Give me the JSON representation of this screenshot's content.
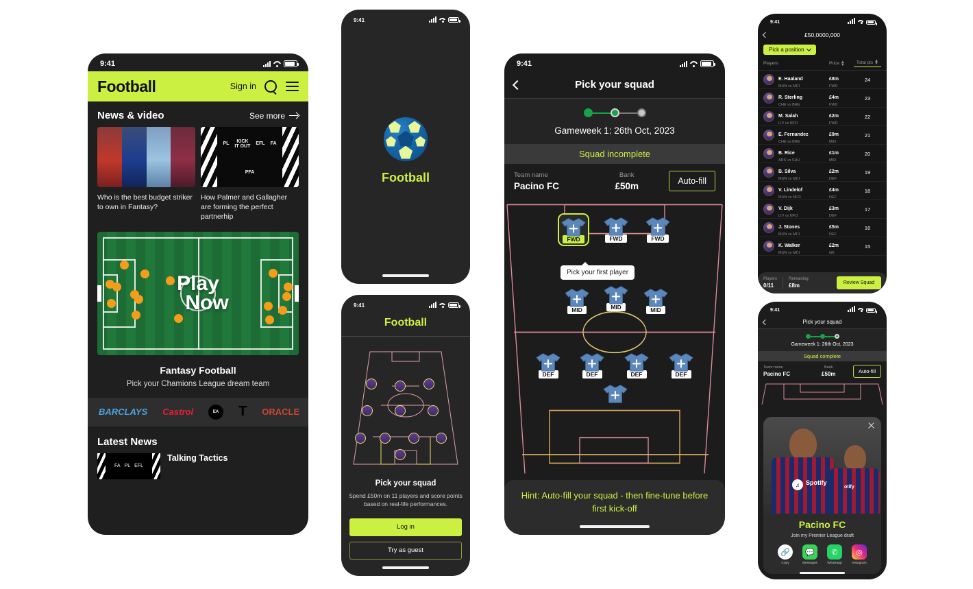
{
  "colors": {
    "accent": "#ccf042",
    "dark_bg": "#1c1c1c",
    "panel": "#2c2c2c",
    "green_step": "#16a34a"
  },
  "status_bar": {
    "time": "9:41",
    "signal_icon": "signal-bars-icon",
    "wifi_icon": "wifi-icon",
    "battery_icon": "battery-icon"
  },
  "home_screen": {
    "brand": "Football",
    "sign_in": "Sign in",
    "search_icon": "search-icon",
    "menu_icon": "hamburger-menu-icon",
    "news_section": {
      "title": "News & video",
      "see_more": "See more",
      "arrow_icon": "arrow-right-icon",
      "cards": [
        {
          "caption": "Who is the best budget striker to own in Fantasy?",
          "thumb": "players-photo"
        },
        {
          "caption": "How Palmer and Gallagher are forming the perfect partnerhip",
          "thumb": "league-logos"
        }
      ],
      "badge_logos": [
        "Premier League",
        "Kick It Out",
        "EFL",
        "The FA",
        "PFA"
      ]
    },
    "promo": {
      "cta_line1": "Play",
      "cta_line2": "Now",
      "title": "Fantasy Football",
      "subtitle": "Pick your Chamions League dream team"
    },
    "sponsors": [
      "BARCLAYS",
      "Castrol",
      "EA SPORTS",
      "T",
      "ORACLE"
    ],
    "latest_news": {
      "title": "Latest News",
      "items": [
        {
          "headline": "Talking Tactics"
        }
      ]
    }
  },
  "splash_screen": {
    "logo_icon": "football-ball-icon",
    "brand": "Football"
  },
  "login_screen": {
    "brand": "Football",
    "heading": "Pick your squad",
    "subtext": "Spend £50m on 11 players and score points based on real-life performances.",
    "primary_button": "Log in",
    "secondary_button": "Try as guest"
  },
  "squad_screen": {
    "back_icon": "chevron-left-icon",
    "title": "Pick your squad",
    "steps": {
      "total": 3,
      "completed": 2
    },
    "gameweek": "Gameweek 1: 26th Oct, 2023",
    "status": "Squad incomplete",
    "team_name_label": "Team name",
    "team_name": "Pacino FC",
    "bank_label": "Bank",
    "bank": "£50m",
    "autofill_button": "Auto-fill",
    "tooltip": "Pick your first player",
    "formation": {
      "forwards": [
        "FWD",
        "FWD",
        "FWD"
      ],
      "midfielders": [
        "MID",
        "MID",
        "MID"
      ],
      "defenders": [
        "DEF",
        "DEF",
        "DEF",
        "DEF"
      ],
      "goalkeeper": ""
    },
    "hint": "Hint: Auto-fill your squad - then fine-tune before first kick-off"
  },
  "player_list_screen": {
    "back_icon": "chevron-left-icon",
    "budget_title": "£50,0000,000",
    "position_filter": "Pick a position",
    "chevron_icon": "chevron-down-icon",
    "columns": [
      "Players",
      "Price",
      "Total pts"
    ],
    "rows": [
      {
        "name": "E. Haaland",
        "match": "MUN vs MCI",
        "price": "£8m",
        "pos": "FWD",
        "pts": "24"
      },
      {
        "name": "R. Sterling",
        "match": "CHE vs BRE",
        "price": "£4m",
        "pos": "FWD",
        "pts": "23"
      },
      {
        "name": "M. Salah",
        "match": "LIV vs NFO",
        "price": "£2m",
        "pos": "FWD",
        "pts": "22"
      },
      {
        "name": "E. Fernandez",
        "match": "CHE vs BRE",
        "price": "£9m",
        "pos": "MID",
        "pts": "21"
      },
      {
        "name": "B. Rice",
        "match": "ARS vs SHU",
        "price": "£1m",
        "pos": "MID",
        "pts": "20"
      },
      {
        "name": "B. Silva",
        "match": "MUN vs MCI",
        "price": "£2m",
        "pos": "DEF",
        "pts": "19"
      },
      {
        "name": "V. Lindelof",
        "match": "MUN vs NFO",
        "price": "£4m",
        "pos": "DEF",
        "pts": "18"
      },
      {
        "name": "V. Dijk",
        "match": "LIV vs NFO",
        "price": "£3m",
        "pos": "DEF",
        "pts": "17"
      },
      {
        "name": "J. Stones",
        "match": "MUN vs MCI",
        "price": "£5m",
        "pos": "DEF",
        "pts": "16"
      },
      {
        "name": "K. Walker",
        "match": "MUN vs MCI",
        "price": "£2m",
        "pos": "GK",
        "pts": "15"
      }
    ],
    "footer": {
      "players_label": "Players",
      "players_value": "0/11",
      "remaining_label": "Remaining",
      "remaining_value": "£8m",
      "review_button": "Review Squad"
    }
  },
  "share_screen": {
    "back_icon": "chevron-left-icon",
    "title": "Pick your squad",
    "gameweek": "Gameweek 1: 26th Oct, 2023",
    "status": "Squad complete",
    "team_name_label": "Team name",
    "team_name": "Pacino FC",
    "bank_label": "Bank",
    "bank": "£50m",
    "autofill_button": "Auto-fill",
    "close_icon": "close-icon",
    "share_title": "Pacino FC",
    "share_subtitle": "Join my Premier League draft",
    "share_targets": [
      {
        "label": "Copy",
        "icon": "link-icon"
      },
      {
        "label": "Messages",
        "icon": "messages-icon"
      },
      {
        "label": "Whatsapp",
        "icon": "whatsapp-icon"
      },
      {
        "label": "Instagram",
        "icon": "instagram-icon"
      }
    ]
  }
}
